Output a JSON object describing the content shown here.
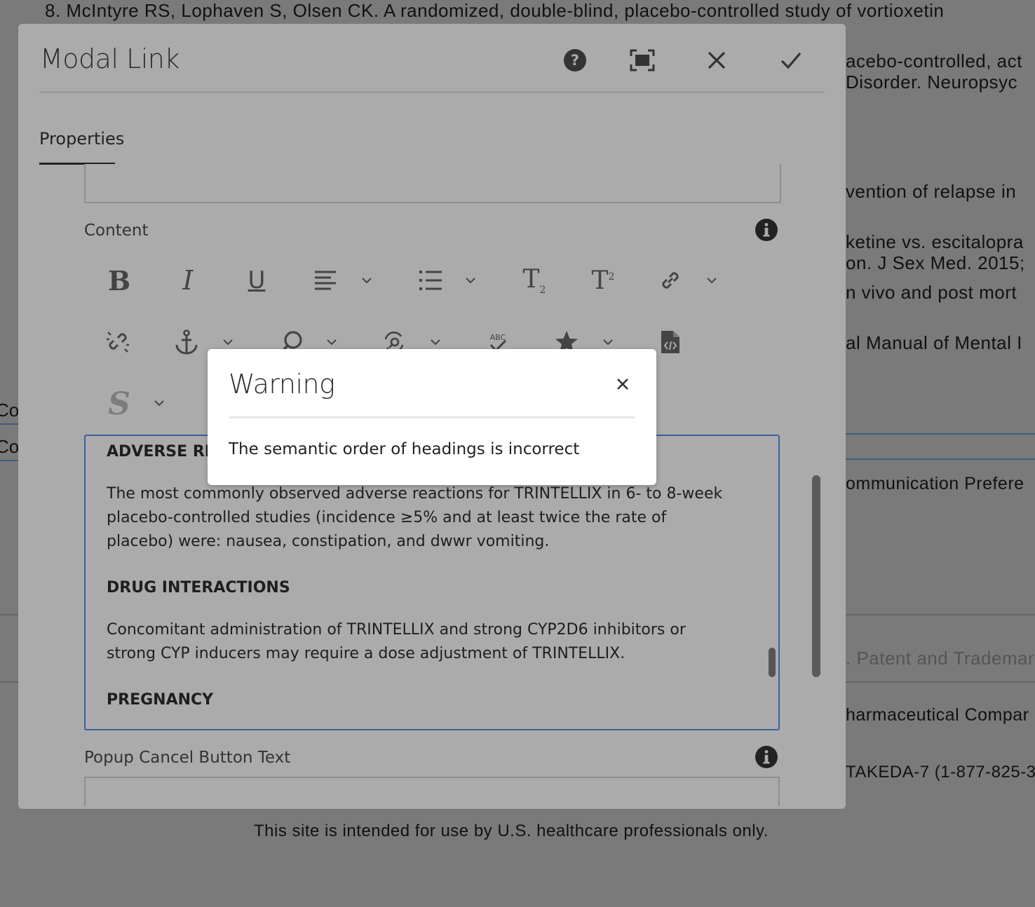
{
  "background_page": {
    "lines": [
      {
        "text": "8. McIntyre RS, Lophaven S, Olsen CK. A randomized, double-blind, placebo-controlled study of vortioxetin",
        "bold_prefix": "8."
      },
      {
        "text": "acebo-controlled, act"
      },
      {
        "text": "Disorder. Neuropsyc"
      },
      {
        "text": "vention of relapse in"
      },
      {
        "text": "ketine vs. escitalopra"
      },
      {
        "text": "on. J Sex Med. 2015;"
      },
      {
        "text": "n vivo and post mort"
      },
      {
        "text": "al Manual of Mental I"
      },
      {
        "text": "ommunication Prefere"
      },
      {
        "text": ". Patent and Trademar"
      },
      {
        "text": "harmaceutical Compar"
      },
      {
        "text": "TAKEDA-7 (1-877-825-3"
      }
    ],
    "left_edge_1": "Co",
    "left_edge_2": "Co",
    "footer_note": "This site is intended for use by U.S. healthcare professionals only."
  },
  "dialog": {
    "title": "Modal Link",
    "header_buttons": [
      "help-icon",
      "fullscreen-icon",
      "close-icon",
      "checkmark-icon"
    ],
    "tabs": [
      {
        "label": "Properties",
        "active": true
      }
    ],
    "content_label": "Content",
    "toolbar_row1": [
      "bold",
      "italic",
      "underline",
      "align",
      "list",
      "subscript",
      "superscript",
      "link"
    ],
    "toolbar_row2": [
      "unlink",
      "anchor",
      "find",
      "find-replace",
      "spellcheck",
      "special-characters",
      "source-edit"
    ],
    "toolbar_row3": [
      "styles"
    ],
    "toolbar_text": {
      "bold": "B",
      "italic": "I",
      "underline": "U",
      "sub": "T",
      "sub_mark": "2",
      "sup": "T",
      "sup_mark": "2",
      "abc": "ABC",
      "styles": "S"
    },
    "editor": {
      "heading_1": "ADVERSE REA",
      "paragraph_1": "The most commonly observed adverse reactions for TRINTELLIX in 6- to 8-week placebo-controlled studies (incidence ≥5% and at least twice the rate of placebo) were: nausea, constipation, and dwwr vomiting.",
      "heading_2": "DRUG INTERACTIONS",
      "paragraph_2": "Concomitant administration of TRINTELLIX and strong CYP2D6 inhibitors or strong CYP inducers may require a dose adjustment of TRINTELLIX.",
      "heading_3": "PREGNANCY"
    },
    "popup_cancel_label": "Popup Cancel Button Text"
  },
  "warning": {
    "title": "Warning",
    "message": "The semantic order of headings is incorrect"
  },
  "colors": {
    "overlay_bg": "#7a7a7a",
    "dialog_bg": "#ababab",
    "editor_border": "#3d5f9a",
    "bg_rule_blue": "#3b5d86"
  }
}
